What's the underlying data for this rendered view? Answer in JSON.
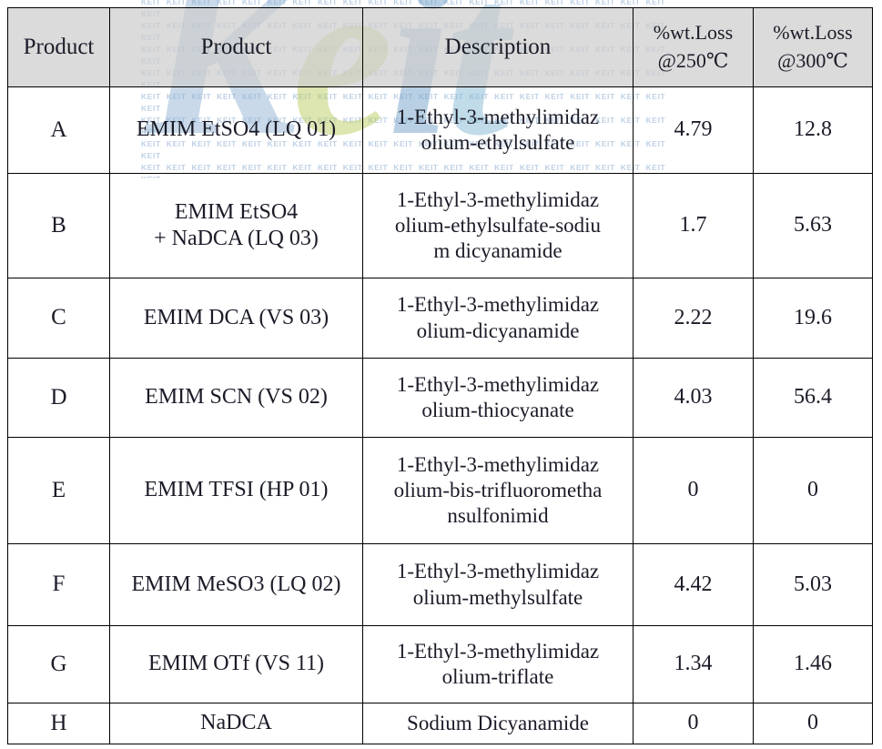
{
  "watermark": {
    "big_text_parts": [
      "K",
      "e",
      "i",
      "t"
    ],
    "tile_text": "KEIT",
    "colors": {
      "k": "#8fb0d3",
      "e": "#b9c95c",
      "i": "#6f9fc8",
      "t": "#7fb6d3",
      "tile": "#a9c2dd"
    }
  },
  "table": {
    "headers": {
      "product_code": "Product",
      "product_name": "Product",
      "description": "Description",
      "loss_250_line1": "%wt.Loss",
      "loss_250_line2": "@250℃",
      "loss_300_line1": "%wt.Loss",
      "loss_300_line2": "@300℃"
    },
    "rows": [
      {
        "code": "A",
        "name_lines": [
          "EMIM EtSO4 (LQ 01)"
        ],
        "desc_lines": [
          "1-Ethyl-3-methylimidaz",
          "olium-ethylsulfate"
        ],
        "loss250": "4.79",
        "loss300": "12.8"
      },
      {
        "code": "B",
        "name_lines": [
          "EMIM EtSO4",
          "+ NaDCA (LQ 03)"
        ],
        "desc_lines": [
          "1-Ethyl-3-methylimidaz",
          "olium-ethylsulfate-sodiu",
          "m dicyanamide"
        ],
        "loss250": "1.7",
        "loss300": "5.63"
      },
      {
        "code": "C",
        "name_lines": [
          "EMIM DCA (VS 03)"
        ],
        "desc_lines": [
          "1-Ethyl-3-methylimidaz",
          "olium-dicyanamide"
        ],
        "loss250": "2.22",
        "loss300": "19.6"
      },
      {
        "code": "D",
        "name_lines": [
          "EMIM SCN  (VS 02)"
        ],
        "desc_lines": [
          "1-Ethyl-3-methylimidaz",
          "olium-thiocyanate"
        ],
        "loss250": "4.03",
        "loss300": "56.4"
      },
      {
        "code": "E",
        "name_lines": [
          "EMIM TFSI (HP 01)"
        ],
        "desc_lines": [
          "1-Ethyl-3-methylimidaz",
          "olium-bis-trifluorometha",
          "nsulfonimid"
        ],
        "loss250": "0",
        "loss300": "0"
      },
      {
        "code": "F",
        "name_lines": [
          "EMIM MeSO3 (LQ 02)"
        ],
        "desc_lines": [
          "1-Ethyl-3-methylimidaz",
          "olium-methylsulfate"
        ],
        "loss250": "4.42",
        "loss300": "5.03"
      },
      {
        "code": "G",
        "name_lines": [
          "EMIM OTf (VS 11)"
        ],
        "desc_lines": [
          "1-Ethyl-3-methylimidaz",
          "olium-triflate"
        ],
        "loss250": "1.34",
        "loss300": "1.46"
      },
      {
        "code": "H",
        "name_lines": [
          "NaDCA"
        ],
        "desc_lines": [
          "Sodium Dicyanamide"
        ],
        "loss250": "0",
        "loss300": "0"
      }
    ]
  }
}
